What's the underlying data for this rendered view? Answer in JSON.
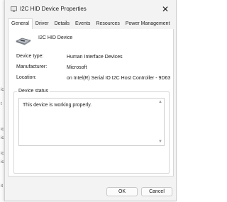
{
  "dialog": {
    "title": "I2C HID Device Properties",
    "close_glyph": "✕"
  },
  "tabs": [
    {
      "label": "General",
      "active": true
    },
    {
      "label": "Driver",
      "active": false
    },
    {
      "label": "Details",
      "active": false
    },
    {
      "label": "Events",
      "active": false
    },
    {
      "label": "Resources",
      "active": false
    },
    {
      "label": "Power Management",
      "active": false
    }
  ],
  "device": {
    "name": "I2C HID Device",
    "icon": "hid-device-icon",
    "properties": [
      {
        "label": "Device type:",
        "value": "Human Interface Devices"
      },
      {
        "label": "Manufacturer:",
        "value": "Microsoft"
      },
      {
        "label": "Location:",
        "value": "on Intel(R) Serial IO I2C Host Controller - 9D63"
      }
    ]
  },
  "status": {
    "legend": "Device status",
    "text": "This device is working properly."
  },
  "buttons": {
    "ok": "OK",
    "cancel": "Cancel"
  },
  "background_fragments": [
    "ic",
    "t",
    "ic",
    "ic",
    "ic",
    "ic",
    "it"
  ],
  "colors": {
    "dialog_bg": "#f3f3f3",
    "panel_bg": "#ffffff",
    "border": "#d7d7d7"
  }
}
